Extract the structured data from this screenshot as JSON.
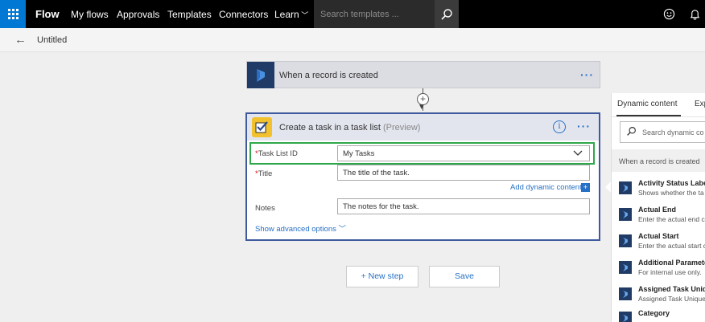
{
  "topbar": {
    "brand": "Flow",
    "nav": [
      "My flows",
      "Approvals",
      "Templates",
      "Connectors",
      "Learn"
    ],
    "search_placeholder": "Search templates ..."
  },
  "subheader": {
    "title": "Untitled"
  },
  "trigger": {
    "title": "When a record is created"
  },
  "action": {
    "title": "Create a task in a task list",
    "preview": "(Preview)",
    "fields": {
      "task_list_label": "Task List ID",
      "task_list_value": "My Tasks",
      "title_label": "Title",
      "title_placeholder": "The title of the task.",
      "notes_label": "Notes",
      "notes_placeholder": "The notes for the task."
    },
    "add_dynamic": "Add dynamic content",
    "show_advanced": "Show advanced options"
  },
  "buttons": {
    "new_step": "+ New step",
    "save": "Save"
  },
  "dynamic_panel": {
    "tab_active": "Dynamic content",
    "tab_other": "Exp",
    "search_placeholder": "Search dynamic co",
    "section": "When a record is created",
    "items": [
      {
        "title": "Activity Status Label",
        "desc": "Shows whether the ta"
      },
      {
        "title": "Actual End",
        "desc": "Enter the actual end c"
      },
      {
        "title": "Actual Start",
        "desc": "Enter the actual start c"
      },
      {
        "title": "Additional Paramete",
        "desc": "For internal use only."
      },
      {
        "title": "Assigned Task Unique",
        "desc": "Assigned Task Unique"
      },
      {
        "title": "Category",
        "desc": ""
      }
    ]
  },
  "colors": {
    "accent": "#2670c5",
    "topbar": "#000000",
    "waffle": "#0078d4",
    "highlight": "#2ea84a",
    "dynamics": "#1f3b66",
    "todo": "#f2c12e"
  }
}
